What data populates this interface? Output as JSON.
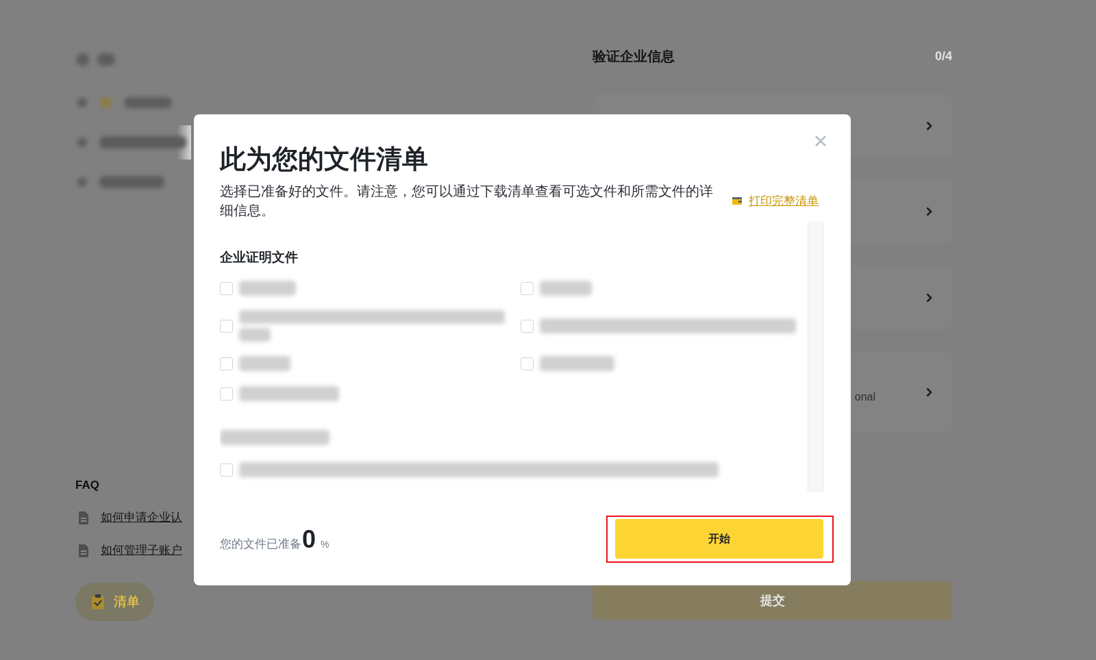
{
  "background_page": {
    "left_panel": {
      "nav_items": [
        {
          "selected": false
        },
        {
          "selected": true
        },
        {
          "selected": false
        }
      ],
      "faq_title": "FAQ",
      "faq_links": [
        "如何申请企业认",
        "如何管理子账户"
      ],
      "checklist_button": "清单"
    },
    "right_panel": {
      "title": "验证企业信息",
      "progress": "0/4",
      "step_fragment": "onal",
      "submit_button": {
        "label": "提交",
        "disabled": true
      }
    }
  },
  "modal": {
    "title": "此为您的文件清单",
    "description": "选择已准备好的文件。请注意，您可以通过下载清单查看可选文件和所需文件的详细信息。",
    "print_link": "打印完整清单",
    "sections": [
      {
        "heading": "企业证明文件",
        "items": [
          {
            "checked": false
          },
          {
            "checked": false
          },
          {
            "checked": false
          },
          {
            "checked": false
          },
          {
            "checked": false
          },
          {
            "checked": false
          },
          {
            "checked": false
          }
        ]
      },
      {
        "items": [
          {
            "checked": false
          }
        ]
      }
    ],
    "progress_label": "您的文件已准备",
    "progress_value": "0",
    "progress_unit": "%",
    "start_button": {
      "label": "开始",
      "highlighted": true
    }
  }
}
